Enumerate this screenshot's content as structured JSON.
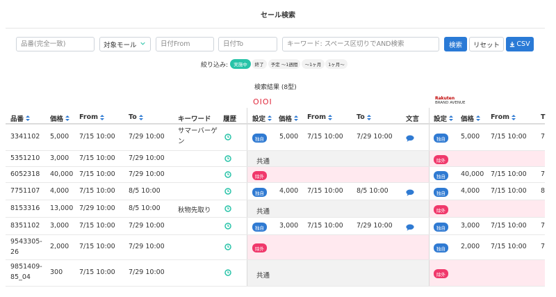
{
  "page_title": "セール検索",
  "search": {
    "part_number_placeholder": "品番(完全一致)",
    "target_mall_label": "対象モール",
    "date_from_placeholder": "日付From",
    "date_to_placeholder": "日付To",
    "keyword_placeholder": "キーワード: スペース区切りでAND検索",
    "search_button": "検索",
    "reset_button": "リセット",
    "csv_button": "CSV"
  },
  "filter": {
    "label": "絞り込み:",
    "options": [
      "実施中",
      "終了",
      "予定 〜1週間",
      "〜1ヶ月",
      "1ヶ月〜"
    ],
    "active_index": 0
  },
  "results": {
    "title": "検索結果 (8型)"
  },
  "brands": {
    "first": "OIOI",
    "second_line1": "Rakuten",
    "second_line2": "BRAND AVENUE"
  },
  "columns": {
    "part_number": "品番",
    "price": "価格",
    "from": "From",
    "to": "To",
    "keyword": "キーワード",
    "history": "履歴",
    "m_setting": "設定",
    "m_price": "価格",
    "m_from": "From",
    "m_to": "To",
    "m_text": "文言",
    "r_setting": "設定",
    "r_price": "価格",
    "r_from": "From",
    "r_to": "T"
  },
  "colors": {
    "accent": "#2a7ad6",
    "active_pill": "#28c3a8",
    "badge_blue": "#2f7ad2",
    "badge_pink": "#f0386b",
    "excluded_row": "#ffe9ef",
    "common_row": "#f2f2f2"
  },
  "rows": [
    {
      "part": "3341102",
      "price": "5,000",
      "from": "7/15 10:00",
      "to": "7/29 10:00",
      "keyword": "サマーバーゲン",
      "m_setting": "独自",
      "m_price": "5,000",
      "m_from": "7/15 10:00",
      "m_to": "7/29 10:00",
      "m_text_icon": true,
      "r_setting": "独自",
      "r_price": "5,000",
      "r_from": "7/15 10:00",
      "r_to": "7"
    },
    {
      "part": "5351210",
      "price": "3,000",
      "from": "7/15 10:00",
      "to": "7/29 10:00",
      "keyword": "",
      "m_setting": "共通",
      "m_price": "",
      "m_from": "",
      "m_to": "",
      "m_text_icon": false,
      "r_setting": "除外",
      "r_price": "",
      "r_from": "",
      "r_to": ""
    },
    {
      "part": "6052318",
      "price": "40,000",
      "from": "7/15 10:00",
      "to": "7/29 10:00",
      "keyword": "",
      "m_setting": "除外",
      "m_price": "",
      "m_from": "",
      "m_to": "",
      "m_text_icon": false,
      "r_setting": "独自",
      "r_price": "40,000",
      "r_from": "7/15 10:00",
      "r_to": "7"
    },
    {
      "part": "7751107",
      "price": "4,000",
      "from": "7/15 10:00",
      "to": "8/5 10:00",
      "keyword": "",
      "m_setting": "独自",
      "m_price": "4,000",
      "m_from": "7/15 10:00",
      "m_to": "8/5 10:00",
      "m_text_icon": true,
      "r_setting": "独自",
      "r_price": "4,000",
      "r_from": "7/15 10:00",
      "r_to": "8"
    },
    {
      "part": "8153316",
      "price": "13,000",
      "from": "7/29 10:00",
      "to": "8/5 10:00",
      "keyword": "秋物先取り",
      "m_setting": "共通",
      "m_price": "",
      "m_from": "",
      "m_to": "",
      "m_text_icon": false,
      "r_setting": "除外",
      "r_price": "",
      "r_from": "",
      "r_to": ""
    },
    {
      "part": "8351102",
      "price": "3,000",
      "from": "7/15 10:00",
      "to": "7/29 10:00",
      "keyword": "",
      "m_setting": "独自",
      "m_price": "3,000",
      "m_from": "7/15 10:00",
      "m_to": "7/29 10:00",
      "m_text_icon": true,
      "r_setting": "独自",
      "r_price": "3,000",
      "r_from": "7/15 10:00",
      "r_to": "7"
    },
    {
      "part": "9543305-26",
      "price": "2,000",
      "from": "7/15 10:00",
      "to": "7/29 10:00",
      "keyword": "",
      "m_setting": "除外",
      "m_price": "",
      "m_from": "",
      "m_to": "",
      "m_text_icon": false,
      "r_setting": "独自",
      "r_price": "2,000",
      "r_from": "7/15 10:00",
      "r_to": "7"
    },
    {
      "part": "9851409-85_04",
      "price": "300",
      "from": "7/15 10:00",
      "to": "7/29 10:00",
      "keyword": "",
      "m_setting": "共通",
      "m_price": "",
      "m_from": "",
      "m_to": "",
      "m_text_icon": false,
      "r_setting": "除外",
      "r_price": "",
      "r_from": "",
      "r_to": ""
    }
  ]
}
